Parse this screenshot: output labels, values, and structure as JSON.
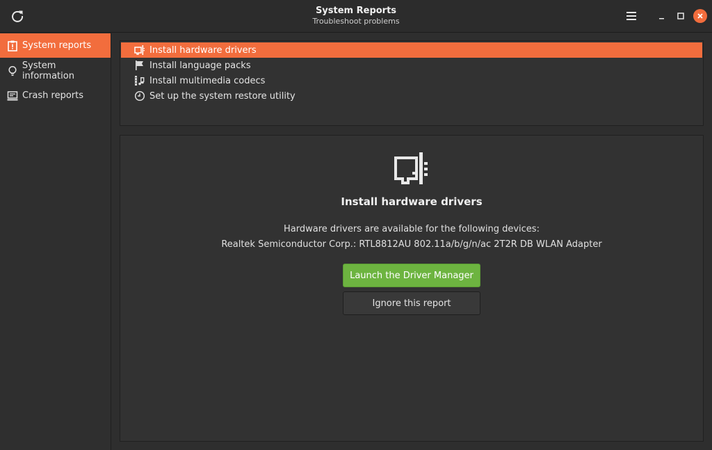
{
  "window": {
    "title": "System Reports",
    "subtitle": "Troubleshoot problems",
    "icons": {
      "refresh": "refresh-icon",
      "menu": "hamburger-menu-icon",
      "minimize": "minimize-icon",
      "maximize": "maximize-icon",
      "close": "close-icon"
    }
  },
  "colors": {
    "accent": "#f26d3d",
    "primary_button": "#6db440",
    "background": "#2e2e2e"
  },
  "sidebar": {
    "items": [
      {
        "label": "System reports",
        "icon": "report-icon",
        "active": true
      },
      {
        "label": "System information",
        "icon": "lightbulb-icon",
        "active": false
      },
      {
        "label": "Crash reports",
        "icon": "monitor-icon",
        "active": false
      }
    ]
  },
  "reports": {
    "items": [
      {
        "label": "Install hardware drivers",
        "icon": "hardware-card-icon",
        "selected": true
      },
      {
        "label": "Install language packs",
        "icon": "flag-icon",
        "selected": false
      },
      {
        "label": "Install multimedia codecs",
        "icon": "film-music-icon",
        "selected": false
      },
      {
        "label": "Set up the system restore utility",
        "icon": "clock-icon",
        "selected": false
      }
    ]
  },
  "detail": {
    "icon": "hardware-card-icon",
    "title": "Install hardware drivers",
    "description": "Hardware drivers are available for the following devices:",
    "device": "Realtek Semiconductor Corp.: RTL8812AU 802.11a/b/g/n/ac 2T2R DB WLAN Adapter",
    "primary_button": "Launch the Driver Manager",
    "secondary_button": "Ignore this report"
  }
}
